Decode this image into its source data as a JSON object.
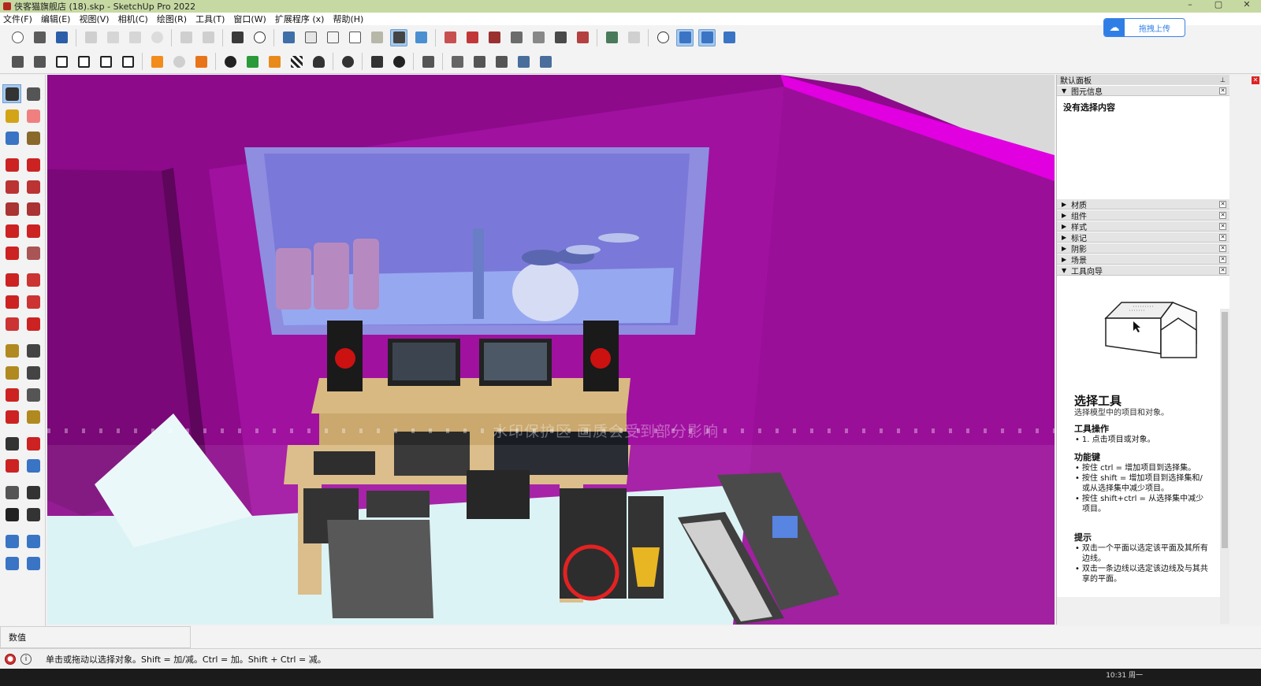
{
  "window": {
    "title": "侠客猫旗舰店 (18).skp - SketchUp Pro 2022",
    "controls": [
      "–",
      "▢",
      "✕"
    ]
  },
  "menu": [
    "文件(F)",
    "编辑(E)",
    "视图(V)",
    "相机(C)",
    "绘图(R)",
    "工具(T)",
    "窗口(W)",
    "扩展程序 (x)",
    "帮助(H)"
  ],
  "upload_button": {
    "label": "拖拽上传"
  },
  "viewport": {
    "watermark": "水印保护区 画质会受到部分影响"
  },
  "tray": {
    "title": "默认面板",
    "entity_info": {
      "header": "图元信息",
      "body": "没有选择内容"
    },
    "sections": [
      "材质",
      "组件",
      "样式",
      "标记",
      "阴影",
      "场景"
    ],
    "instructor": {
      "header": "工具向导",
      "tool_name": "选择工具",
      "tool_desc": "选择模型中的项目和对象。",
      "ops_title": "工具操作",
      "ops": "1. 点击项目或对象。",
      "keys_title": "功能键",
      "keys": [
        "按住 ctrl = 增加项目到选择集。",
        "按住 shift = 增加项目到选择集和/或从选择集中减少项目。",
        "按住 shift+ctrl = 从选择集中减少项目。"
      ],
      "tips_title": "提示",
      "tips": [
        "双击一个平面以选定该平面及其所有边线。",
        "双击一条边线以选定该边线及与其共享的平面。"
      ]
    }
  },
  "measurements": {
    "label": "数值"
  },
  "status": {
    "message": "单击或拖动以选择对象。Shift = 加/减。Ctrl = 加。Shift + Ctrl = 减。"
  },
  "taskbar": {
    "clock": "10:31 周一"
  },
  "colors": {
    "wall": "#8d0a8b",
    "wall_light": "#b21ab0",
    "floor": "#d9f2f5",
    "glass": "#7a78d8",
    "desk": "#d8b982"
  }
}
